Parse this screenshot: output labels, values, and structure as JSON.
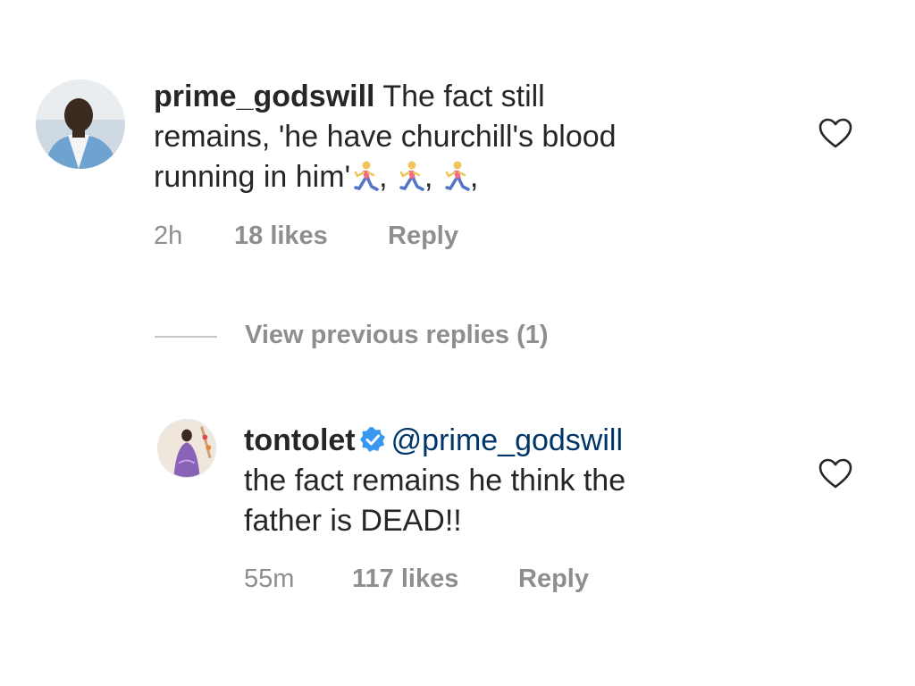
{
  "comments": [
    {
      "username": "prime_godswill",
      "lines": [
        "The fact still",
        "remains, 'he have churchill's blood",
        "running in him'"
      ],
      "emoji_sep": ",",
      "emoji_name": "man-running-icon",
      "time": "2h",
      "likes": "18 likes",
      "reply_label": "Reply"
    },
    {
      "username": "tontolet",
      "verified": true,
      "mention": "@prime_godswill",
      "lines": [
        "the fact remains he think the",
        "father is DEAD!!"
      ],
      "time": "55m",
      "likes": "117 likes",
      "reply_label": "Reply"
    }
  ],
  "view_previous_replies": "View previous replies (1)",
  "colors": {
    "text": "#262626",
    "meta": "#8e8e8e",
    "mention": "#003569",
    "verified": "#3897f0"
  }
}
